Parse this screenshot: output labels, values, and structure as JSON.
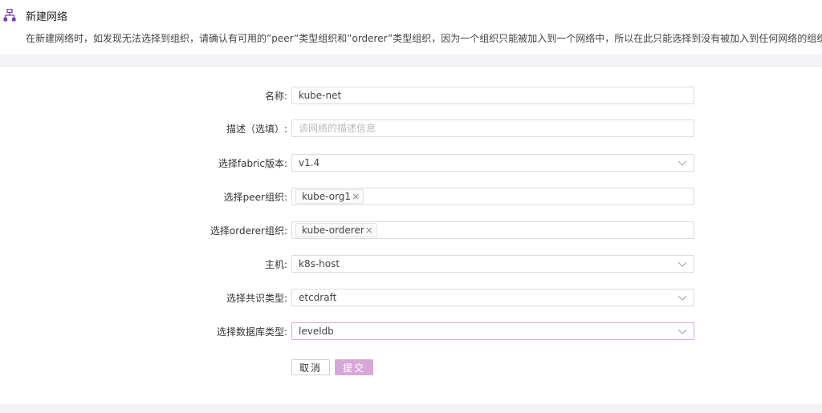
{
  "header": {
    "title": "新建网络",
    "icon": "network-icon",
    "description": "在新建网络时，如发现无法选择到组织，请确认有可用的”peer”类型组织和”orderer”类型组织，因为一个组织只能被加入到一个网络中，所以在此只能选择到没有被加入到任何网络的组织。"
  },
  "form": {
    "name": {
      "label": "名称:",
      "value": "kube-net"
    },
    "description": {
      "label": "描述（选填）:",
      "placeholder": "该网络的描述信息",
      "value": ""
    },
    "fabric_version": {
      "label": "选择fabric版本:",
      "value": "v1.4"
    },
    "peer_orgs": {
      "label": "选择peer组织:",
      "tags": [
        "kube-org1"
      ]
    },
    "orderer_orgs": {
      "label": "选择orderer组织:",
      "tags": [
        "kube-orderer"
      ]
    },
    "host": {
      "label": "主机:",
      "value": "k8s-host"
    },
    "consensus": {
      "label": "选择共识类型:",
      "value": "etcdraft"
    },
    "database": {
      "label": "选择数据库类型:",
      "value": "leveldb"
    }
  },
  "tag_remove_glyph": "×",
  "buttons": {
    "cancel": "取消",
    "submit": "提交"
  },
  "colors": {
    "accent": "#7b3fb5",
    "submit_bg": "#d7a8d7",
    "focus_border": "#d9a6d9"
  }
}
